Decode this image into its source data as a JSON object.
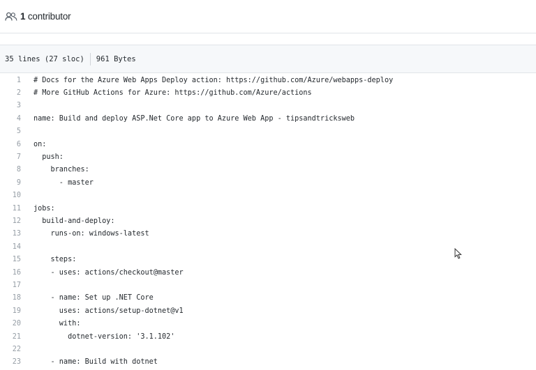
{
  "contributors": {
    "count": "1",
    "label": "contributor",
    "icon": "people-icon"
  },
  "file_info": {
    "lines": "35 lines (27 sloc)",
    "size": "961 Bytes"
  },
  "code_lines": [
    {
      "num": "1",
      "text": "# Docs for the Azure Web Apps Deploy action: https://github.com/Azure/webapps-deploy"
    },
    {
      "num": "2",
      "text": "# More GitHub Actions for Azure: https://github.com/Azure/actions"
    },
    {
      "num": "3",
      "text": ""
    },
    {
      "num": "4",
      "text": "name: Build and deploy ASP.Net Core app to Azure Web App - tipsandtricksweb"
    },
    {
      "num": "5",
      "text": ""
    },
    {
      "num": "6",
      "text": "on:"
    },
    {
      "num": "7",
      "text": "  push:"
    },
    {
      "num": "8",
      "text": "    branches:"
    },
    {
      "num": "9",
      "text": "      - master"
    },
    {
      "num": "10",
      "text": ""
    },
    {
      "num": "11",
      "text": "jobs:"
    },
    {
      "num": "12",
      "text": "  build-and-deploy:"
    },
    {
      "num": "13",
      "text": "    runs-on: windows-latest"
    },
    {
      "num": "14",
      "text": ""
    },
    {
      "num": "15",
      "text": "    steps:"
    },
    {
      "num": "16",
      "text": "    - uses: actions/checkout@master"
    },
    {
      "num": "17",
      "text": ""
    },
    {
      "num": "18",
      "text": "    - name: Set up .NET Core"
    },
    {
      "num": "19",
      "text": "      uses: actions/setup-dotnet@v1"
    },
    {
      "num": "20",
      "text": "      with:"
    },
    {
      "num": "21",
      "text": "        dotnet-version: '3.1.102'"
    },
    {
      "num": "22",
      "text": ""
    },
    {
      "num": "23",
      "text": "    - name: Build with dotnet"
    }
  ],
  "colors": {
    "line_number": "#959da5",
    "header_bg": "#f6f8fa",
    "border": "#e1e4e8"
  }
}
